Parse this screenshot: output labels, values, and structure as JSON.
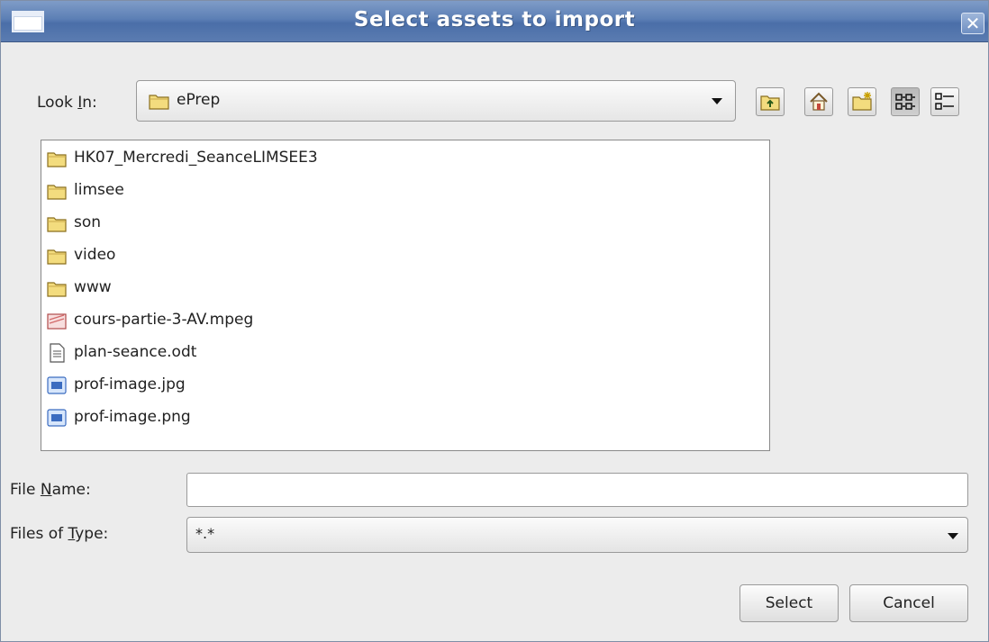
{
  "window": {
    "title": "Select assets to import",
    "close_label": "✕"
  },
  "look_in": {
    "label_prefix": "Look ",
    "label_mnemonic": "I",
    "label_suffix": "n:",
    "value": "ePrep"
  },
  "toolbar": {
    "buttons": [
      "up-folder-icon",
      "home-icon",
      "new-folder-icon",
      "list-view-icon",
      "details-view-icon"
    ]
  },
  "files": [
    {
      "name": "HK07_Mercredi_SeanceLIMSEE3",
      "icon": "folder-icon"
    },
    {
      "name": "limsee",
      "icon": "folder-icon"
    },
    {
      "name": "son",
      "icon": "folder-icon"
    },
    {
      "name": "video",
      "icon": "folder-icon"
    },
    {
      "name": "www",
      "icon": "folder-icon"
    },
    {
      "name": "cours-partie-3-AV.mpeg",
      "icon": "video-file-icon"
    },
    {
      "name": "plan-seance.odt",
      "icon": "document-file-icon"
    },
    {
      "name": "prof-image.jpg",
      "icon": "image-file-icon"
    },
    {
      "name": "prof-image.png",
      "icon": "image-file-icon"
    }
  ],
  "file_name": {
    "label_prefix": "File ",
    "label_mnemonic": "N",
    "label_suffix": "ame:",
    "value": ""
  },
  "file_type": {
    "label_prefix": "Files of ",
    "label_mnemonic": "T",
    "label_suffix": "ype:",
    "value": "*.*"
  },
  "buttons": {
    "select": "Select",
    "cancel": "Cancel"
  },
  "colors": {
    "titlebar": "#5c7fb5",
    "folder": "#f3dc7e",
    "window_bg": "#ececec"
  }
}
